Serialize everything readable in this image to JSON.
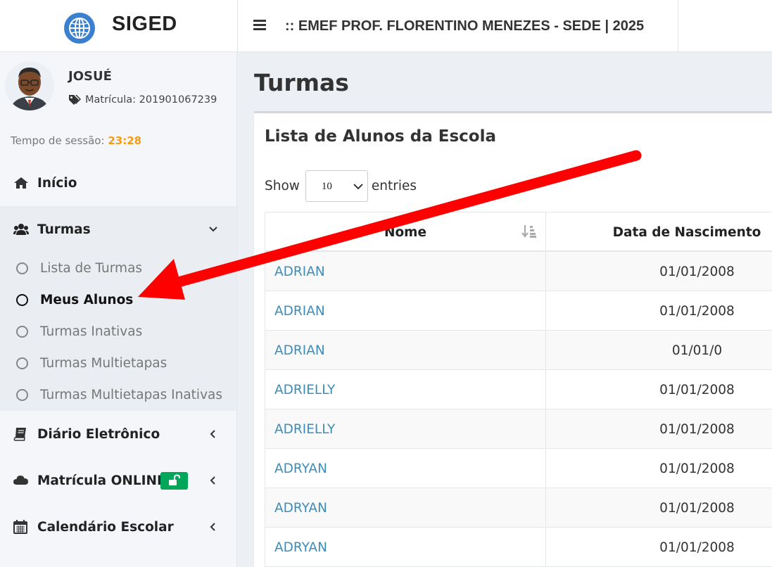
{
  "header": {
    "logo_text": "SIGED",
    "school_title": ":: EMEF PROF. FLORENTINO MENEZES - SEDE | 2025"
  },
  "user": {
    "name": "JOSUÉ",
    "matricula": "Matrícula: 201901067239",
    "session_label": "Tempo de sessão:",
    "session_time": "23:28"
  },
  "menu": {
    "inicio": "Início",
    "turmas": "Turmas",
    "turmas_sub": [
      {
        "label": "Lista de Turmas",
        "active": false
      },
      {
        "label": "Meus Alunos",
        "active": true
      },
      {
        "label": "Turmas Inativas",
        "active": false
      },
      {
        "label": "Turmas Multietapas",
        "active": false
      },
      {
        "label": "Turmas Multietapas Inativas",
        "active": false
      }
    ],
    "diario": "Diário Eletrônico",
    "matricula_online": "Matrícula ONLINE",
    "calendario": "Calendário Escolar"
  },
  "page": {
    "title": "Turmas",
    "card_title": "Lista de Alunos da Escola",
    "show_label": "Show",
    "entries_value": "10",
    "entries_label": "entries"
  },
  "table": {
    "columns": [
      "Nome",
      "Data de Nascimento"
    ],
    "rows": [
      {
        "nome": "ADRIAN",
        "data": "01/01/2008"
      },
      {
        "nome": "ADRIAN",
        "data": "01/01/2008"
      },
      {
        "nome": "ADRIAN",
        "data": "01/01/0"
      },
      {
        "nome": "ADRIELLY",
        "data": "01/01/2008"
      },
      {
        "nome": "ADRIELLY",
        "data": "01/01/2008"
      },
      {
        "nome": "ADRYAN",
        "data": "01/01/2008"
      },
      {
        "nome": "ADRYAN",
        "data": "01/01/2008"
      },
      {
        "nome": "ADRYAN",
        "data": "01/01/2008"
      }
    ]
  },
  "colors": {
    "link": "#3c8dbc",
    "session_time": "#f39c12",
    "badge": "#00a65a",
    "annotation_arrow": "#ff0000"
  }
}
